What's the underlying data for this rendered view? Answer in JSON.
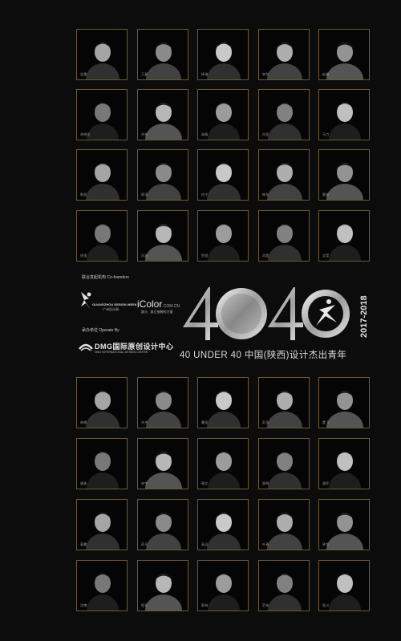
{
  "banner": {
    "cofounders_label": "联合发起机构 Co-founders",
    "guangzhou_design_week": "GUANGZHOU DESIGN WEEK",
    "guangzhou_design_week_cn": "广州设计周",
    "icolor_brand": "iColor",
    "icolor_domain": ".COM.CN",
    "icolor_tagline": "路元 · 真正接触的力量",
    "operate_label": "承办单位 Operate By",
    "dmg_name_cn": "DMG国际原创设计中心",
    "dmg_name_en": "DMG INTERNATIONAL DESIGN CENTER",
    "title_graphic": "4040",
    "year": "2017-2018",
    "subtitle": "40 UNDER 40 中国(陕西)设计杰出青年"
  },
  "portraits_top": [
    {
      "name": "张雯"
    },
    {
      "name": "王磊"
    },
    {
      "name": "杨琳"
    },
    {
      "name": "李剑"
    },
    {
      "name": "赵峰"
    },
    {
      "name": "胡晓龙"
    },
    {
      "name": "刘伟"
    },
    {
      "name": "周倩"
    },
    {
      "name": "孙凯"
    },
    {
      "name": "马力"
    },
    {
      "name": "陈丽"
    },
    {
      "name": "郭涛"
    },
    {
      "name": "何宁"
    },
    {
      "name": "韩东"
    },
    {
      "name": "黄俊"
    },
    {
      "name": "徐强"
    },
    {
      "name": "冯波"
    },
    {
      "name": "罗斌"
    },
    {
      "name": "邓超"
    },
    {
      "name": "吴昊"
    }
  ],
  "portraits_bottom": [
    {
      "name": "林娜"
    },
    {
      "name": "许杰"
    },
    {
      "name": "曹阳"
    },
    {
      "name": "彭浩"
    },
    {
      "name": "董飞"
    },
    {
      "name": "唐勇"
    },
    {
      "name": "宋宇"
    },
    {
      "name": "谢文"
    },
    {
      "name": "邹明"
    },
    {
      "name": "潘军"
    },
    {
      "name": "袁鹏"
    },
    {
      "name": "蒋凡"
    },
    {
      "name": "高远"
    },
    {
      "name": "叶青"
    },
    {
      "name": "钟华"
    },
    {
      "name": "沈博"
    },
    {
      "name": "程亮"
    },
    {
      "name": "蔡林"
    },
    {
      "name": "范伟"
    },
    {
      "name": "陆川"
    }
  ],
  "colors": {
    "frame_gold": "#6d5a36",
    "background": "#0c0c0c",
    "silver": "#c8c8c8"
  }
}
